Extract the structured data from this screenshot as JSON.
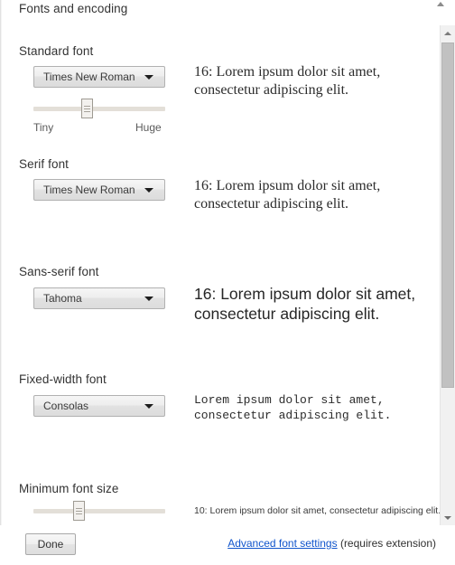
{
  "panel": {
    "title": "Fonts and encoding"
  },
  "sections": [
    {
      "key": "standard",
      "label": "Standard font",
      "dropdown_value": "Times New Roman",
      "preview": "16: Lorem ipsum dolor sit amet, consectetur adipiscing elit.",
      "slider": {
        "min_label": "Tiny",
        "max_label": "Huge",
        "position_percent": 40
      }
    },
    {
      "key": "serif",
      "label": "Serif font",
      "dropdown_value": "Times New Roman",
      "preview": "16: Lorem ipsum dolor sit amet, consectetur adipiscing elit."
    },
    {
      "key": "sans-serif",
      "label": "Sans-serif font",
      "dropdown_value": "Tahoma",
      "preview": "16: Lorem ipsum dolor sit amet, consectetur adipiscing elit."
    },
    {
      "key": "fixed-width",
      "label": "Fixed-width font",
      "dropdown_value": "Consolas",
      "preview": "Lorem ipsum dolor sit amet, consectetur adipiscing elit."
    },
    {
      "key": "minimum-font-size",
      "label": "Minimum font size",
      "preview": "10: Lorem ipsum dolor sit amet, consectetur adipiscing elit.",
      "slider": {
        "position_percent": 33
      }
    }
  ],
  "footer": {
    "done_label": "Done",
    "advanced_link": "Advanced font settings",
    "advanced_note": " (requires extension)"
  },
  "colors": {
    "link": "#1155cc",
    "text": "#333333",
    "track": "#e3dfd8",
    "scrollbar_thumb": "#c1c1c1",
    "scrollbar_track": "#f1f1f1"
  }
}
